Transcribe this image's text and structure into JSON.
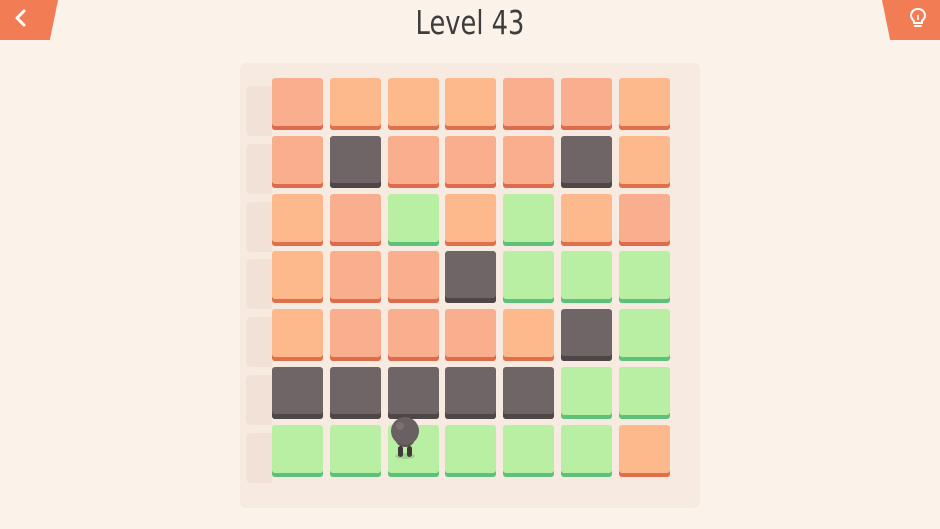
{
  "header": {
    "level_title": "Level 43",
    "back_icon": "chevron-left-icon",
    "hint_icon": "lightbulb-icon"
  },
  "colors": {
    "orange": "#fdb98b",
    "salmon": "#f9ae8d",
    "gray": "#6f6466",
    "green": "#b9efa2",
    "button": "#f27d55"
  },
  "board": {
    "columns": 7,
    "rows": 7,
    "grid": [
      [
        "salmon",
        "orange",
        "orange",
        "orange",
        "salmon",
        "salmon",
        "orange"
      ],
      [
        "salmon",
        "gray",
        "salmon",
        "salmon",
        "salmon",
        "gray",
        "orange"
      ],
      [
        "orange",
        "salmon",
        "green",
        "orange",
        "green",
        "orange",
        "salmon"
      ],
      [
        "orange",
        "salmon",
        "salmon",
        "gray",
        "green",
        "green",
        "green"
      ],
      [
        "orange",
        "salmon",
        "salmon",
        "salmon",
        "orange",
        "gray",
        "green"
      ],
      [
        "gray",
        "gray",
        "gray",
        "gray",
        "gray",
        "green",
        "green"
      ],
      [
        "green",
        "green",
        "green",
        "green",
        "green",
        "green",
        "orange"
      ]
    ],
    "player": {
      "row": 6,
      "col": 2
    }
  }
}
